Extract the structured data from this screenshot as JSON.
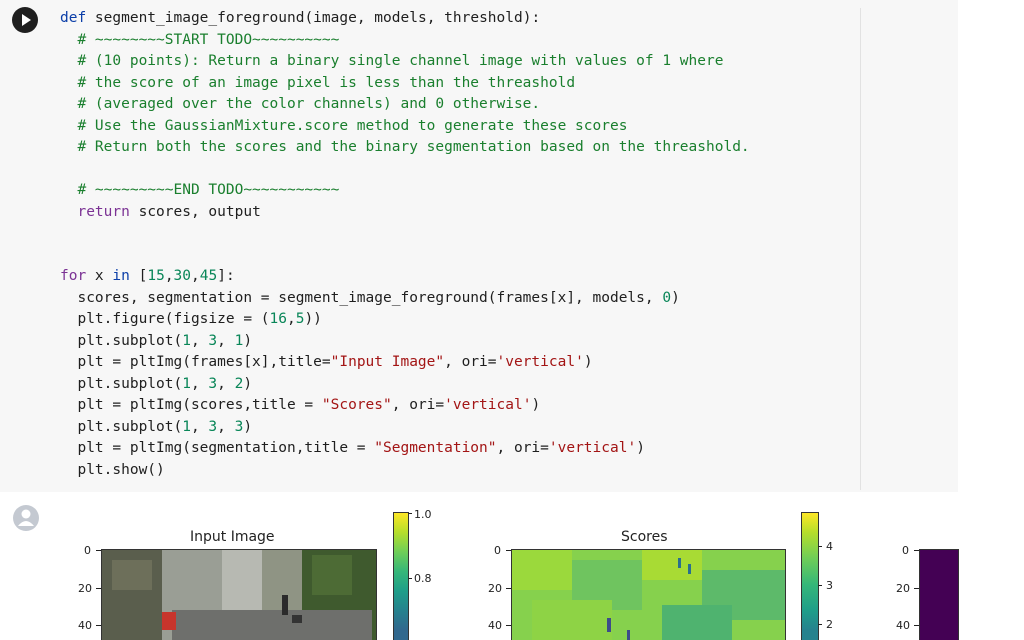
{
  "code_lines": [
    [
      {
        "t": "def ",
        "c": "kwb"
      },
      {
        "t": "segment_image_foreground",
        "c": "punc"
      },
      {
        "t": "(",
        "c": "punc"
      },
      {
        "t": "image",
        "c": "punc"
      },
      {
        "t": ", ",
        "c": "punc"
      },
      {
        "t": "models",
        "c": "punc"
      },
      {
        "t": ", ",
        "c": "punc"
      },
      {
        "t": "threshold",
        "c": "punc"
      },
      {
        "t": "):",
        "c": "punc"
      }
    ],
    [
      {
        "t": "  # ~~~~~~~~START TODO~~~~~~~~~~",
        "c": "cm"
      }
    ],
    [
      {
        "t": "  # (10 points): Return a binary single channel image with values of 1 where",
        "c": "cm"
      }
    ],
    [
      {
        "t": "  # the score of an image pixel is less than the threashold",
        "c": "cm"
      }
    ],
    [
      {
        "t": "  # (averaged over the color channels) and 0 otherwise.",
        "c": "cm"
      }
    ],
    [
      {
        "t": "  # Use the GaussianMixture.score method to generate these scores",
        "c": "cm"
      }
    ],
    [
      {
        "t": "  # Return both the scores and the binary segmentation based on the threashold.",
        "c": "cm"
      }
    ],
    [
      {
        "t": "",
        "c": "punc"
      }
    ],
    [
      {
        "t": "  # ~~~~~~~~~END TODO~~~~~~~~~~~",
        "c": "cm"
      }
    ],
    [
      {
        "t": "  ",
        "c": "punc"
      },
      {
        "t": "return",
        "c": "kw"
      },
      {
        "t": " scores, output",
        "c": "punc"
      }
    ],
    [
      {
        "t": "",
        "c": "punc"
      }
    ],
    [
      {
        "t": "",
        "c": "punc"
      }
    ],
    [
      {
        "t": "for",
        "c": "kw"
      },
      {
        "t": " x ",
        "c": "punc"
      },
      {
        "t": "in",
        "c": "kwb"
      },
      {
        "t": " [",
        "c": "punc"
      },
      {
        "t": "15",
        "c": "num"
      },
      {
        "t": ",",
        "c": "punc"
      },
      {
        "t": "30",
        "c": "num"
      },
      {
        "t": ",",
        "c": "punc"
      },
      {
        "t": "45",
        "c": "num"
      },
      {
        "t": "]:",
        "c": "punc"
      }
    ],
    [
      {
        "t": "  scores, segmentation = segment_image_foreground(frames[x], models, ",
        "c": "punc"
      },
      {
        "t": "0",
        "c": "num"
      },
      {
        "t": ")",
        "c": "punc"
      }
    ],
    [
      {
        "t": "  plt.figure(figsize = (",
        "c": "punc"
      },
      {
        "t": "16",
        "c": "num"
      },
      {
        "t": ",",
        "c": "punc"
      },
      {
        "t": "5",
        "c": "num"
      },
      {
        "t": "))",
        "c": "punc"
      }
    ],
    [
      {
        "t": "  plt.subplot(",
        "c": "punc"
      },
      {
        "t": "1",
        "c": "num"
      },
      {
        "t": ", ",
        "c": "punc"
      },
      {
        "t": "3",
        "c": "num"
      },
      {
        "t": ", ",
        "c": "punc"
      },
      {
        "t": "1",
        "c": "num"
      },
      {
        "t": ")",
        "c": "punc"
      }
    ],
    [
      {
        "t": "  plt = pltImg(frames[x],title=",
        "c": "punc"
      },
      {
        "t": "\"Input Image\"",
        "c": "str"
      },
      {
        "t": ", ori=",
        "c": "punc"
      },
      {
        "t": "'vertical'",
        "c": "str"
      },
      {
        "t": ")",
        "c": "punc"
      }
    ],
    [
      {
        "t": "  plt.subplot(",
        "c": "punc"
      },
      {
        "t": "1",
        "c": "num"
      },
      {
        "t": ", ",
        "c": "punc"
      },
      {
        "t": "3",
        "c": "num"
      },
      {
        "t": ", ",
        "c": "punc"
      },
      {
        "t": "2",
        "c": "num"
      },
      {
        "t": ")",
        "c": "punc"
      }
    ],
    [
      {
        "t": "  plt = pltImg(scores,title = ",
        "c": "punc"
      },
      {
        "t": "\"Scores\"",
        "c": "str"
      },
      {
        "t": ", ori=",
        "c": "punc"
      },
      {
        "t": "'vertical'",
        "c": "str"
      },
      {
        "t": ")",
        "c": "punc"
      }
    ],
    [
      {
        "t": "  plt.subplot(",
        "c": "punc"
      },
      {
        "t": "1",
        "c": "num"
      },
      {
        "t": ", ",
        "c": "punc"
      },
      {
        "t": "3",
        "c": "num"
      },
      {
        "t": ", ",
        "c": "punc"
      },
      {
        "t": "3",
        "c": "num"
      },
      {
        "t": ")",
        "c": "punc"
      }
    ],
    [
      {
        "t": "  plt = pltImg(segmentation,title = ",
        "c": "punc"
      },
      {
        "t": "\"Segmentation\"",
        "c": "str"
      },
      {
        "t": ", ori=",
        "c": "punc"
      },
      {
        "t": "'vertical'",
        "c": "str"
      },
      {
        "t": ")",
        "c": "punc"
      }
    ],
    [
      {
        "t": "  plt.show()",
        "c": "punc"
      }
    ]
  ],
  "output": {
    "plot1": {
      "title": "Input Image",
      "yticks": [
        "0",
        "20",
        "40"
      ],
      "cbar_ticks": [
        "1.0",
        "0.8"
      ]
    },
    "plot2": {
      "title": "Scores",
      "yticks": [
        "0",
        "20",
        "40"
      ],
      "cbar_ticks": [
        "4",
        "3",
        "2"
      ]
    },
    "plot3": {
      "yticks": [
        "0",
        "20",
        "40"
      ]
    }
  },
  "colors": {
    "keyword": "#0b3ea8",
    "control": "#7b3294",
    "string": "#a31515",
    "comment": "#1a7f2e",
    "number": "#098658",
    "cell_bg": "#f7f7f7"
  },
  "icons": {
    "run": "play-icon",
    "output": "output-avatar-icon"
  }
}
